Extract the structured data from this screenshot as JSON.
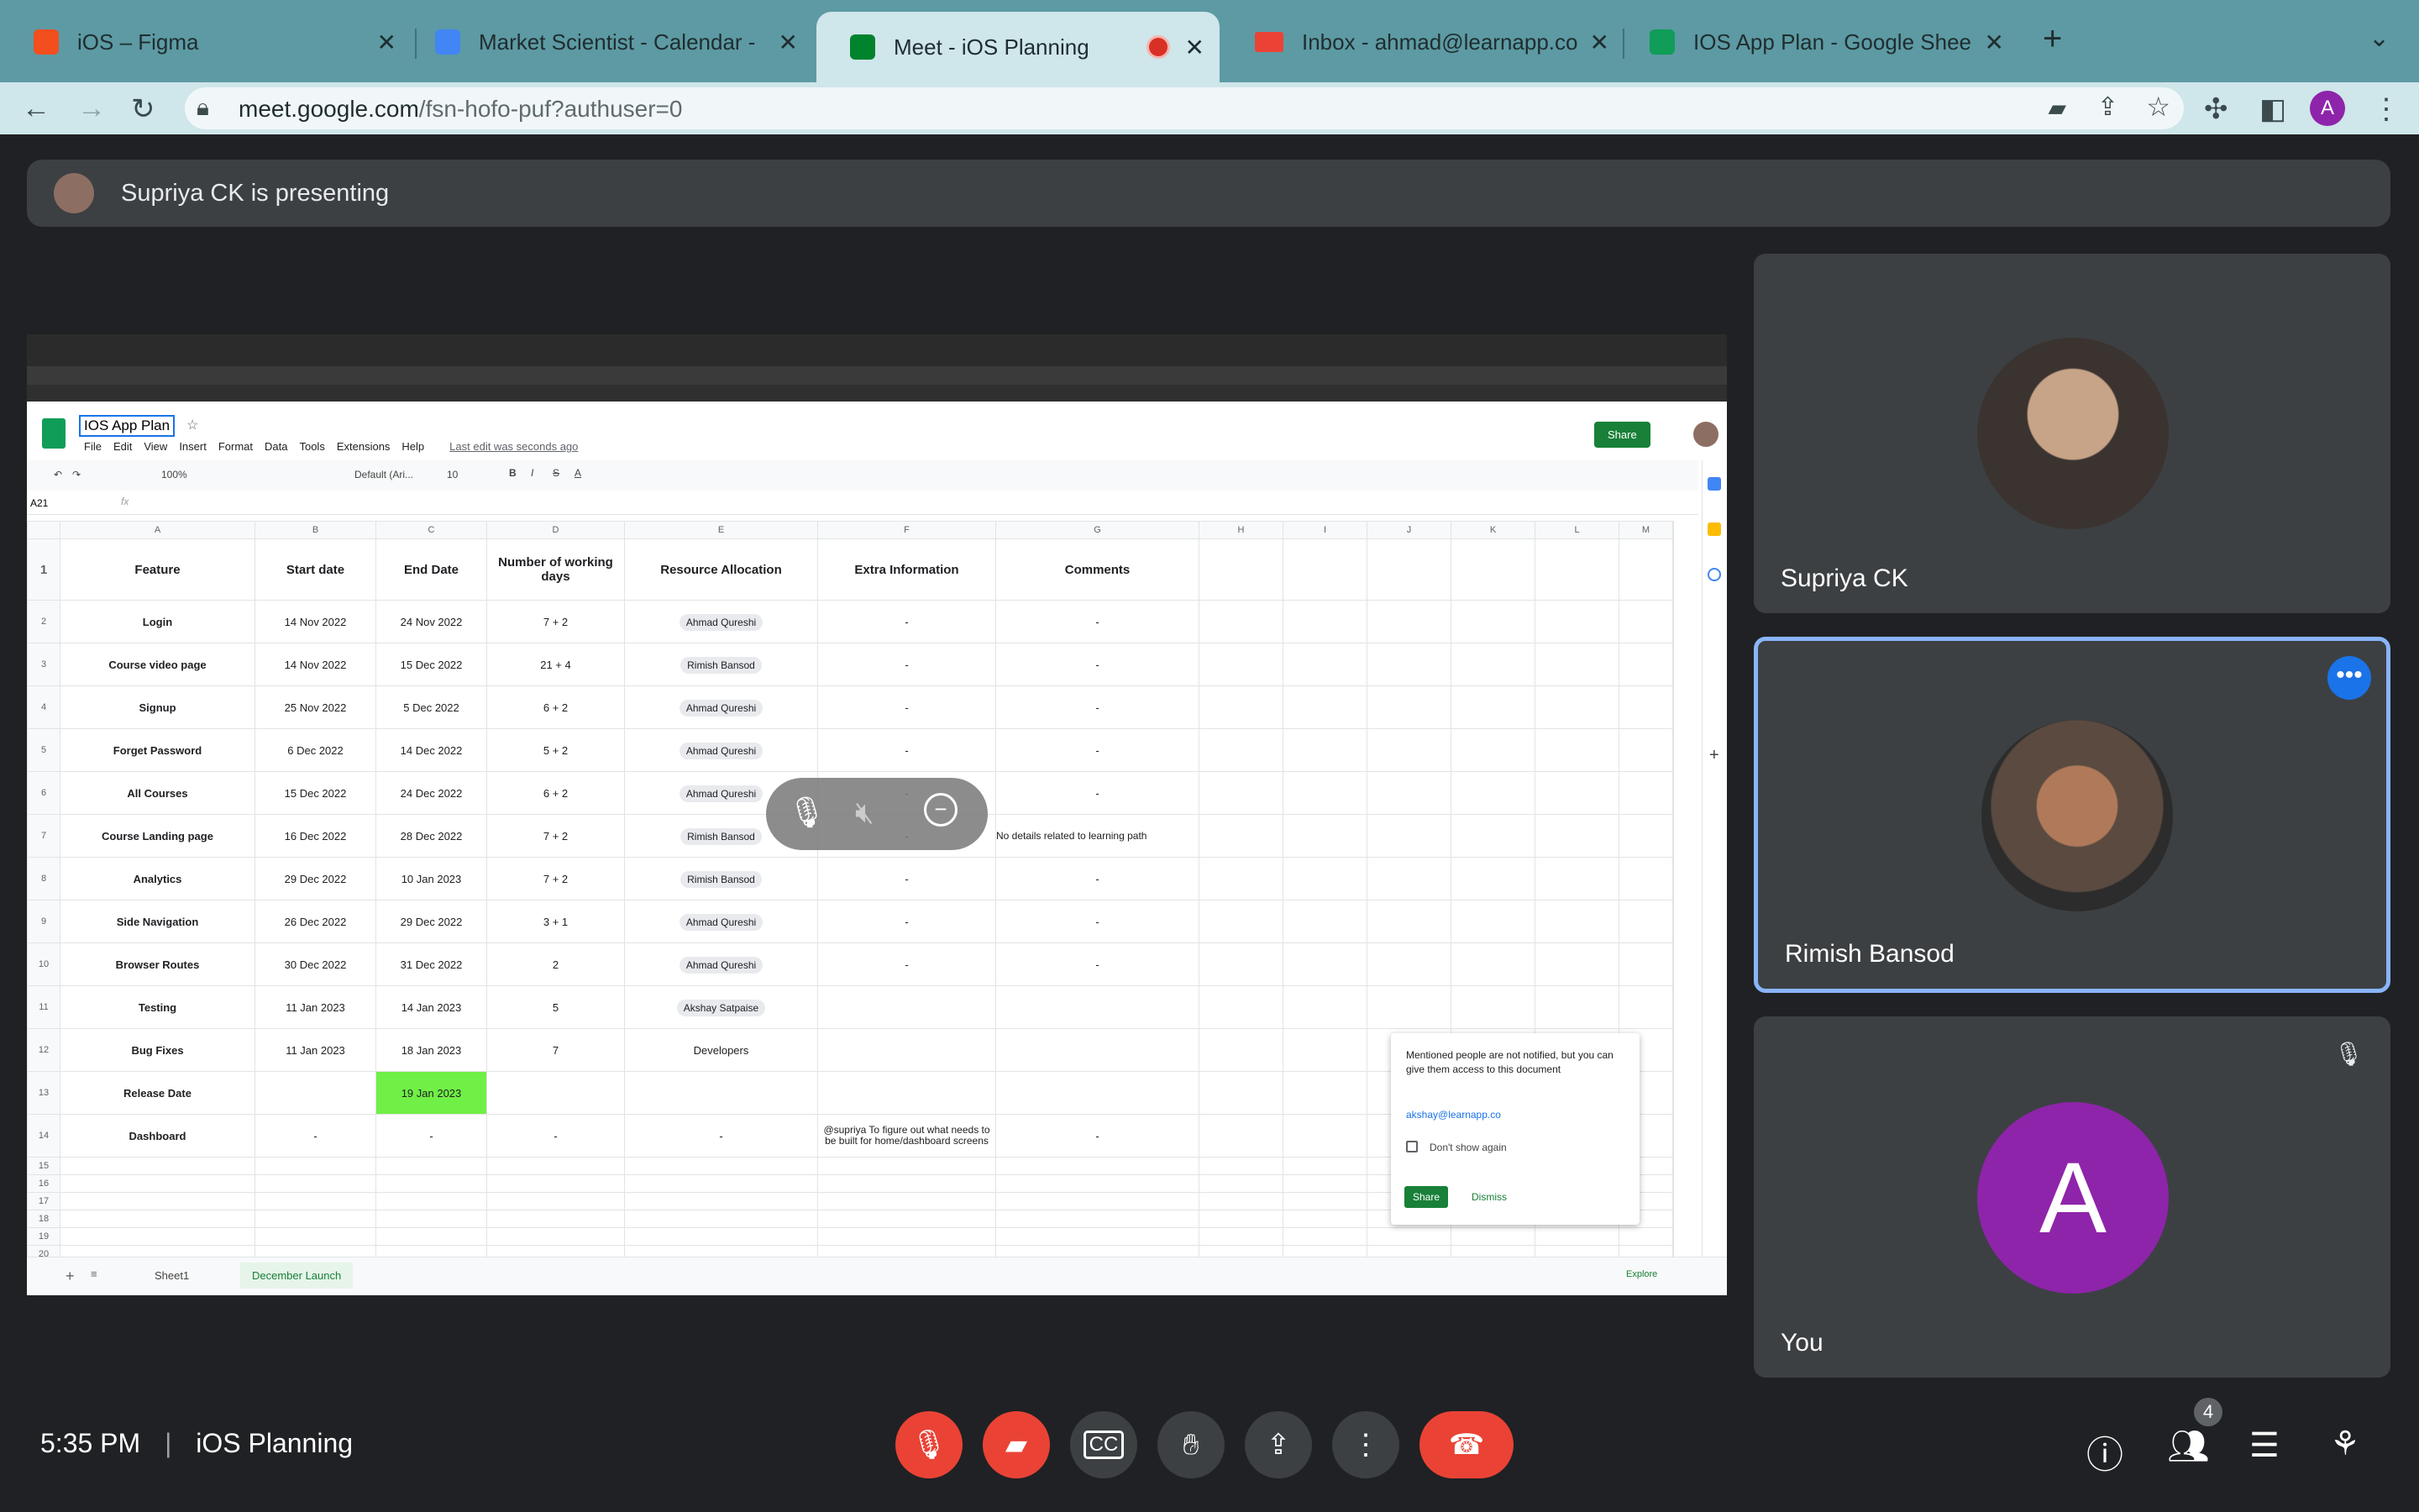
{
  "browser": {
    "tabs": [
      {
        "title": "iOS – Figma",
        "favicon_color": "#f24e1e",
        "active": false
      },
      {
        "title": "Market Scientist - Calendar - W",
        "favicon_color": "#4285f4",
        "active": false
      },
      {
        "title": "Meet - iOS Planning",
        "favicon_color": "#00832d",
        "active": true,
        "recording": true
      },
      {
        "title": "Inbox - ahmad@learnapp.com",
        "favicon_color": "#ea4335",
        "active": false
      },
      {
        "title": "IOS App Plan - Google Sheets",
        "favicon_color": "#0f9d58",
        "active": false
      }
    ],
    "url_domain": "meet.google.com",
    "url_path": "/fsn-hofo-puf?authuser=0",
    "profile_initial": "A",
    "accent": "#5d9aa3"
  },
  "meet": {
    "presenting_text": "Supriya CK is presenting",
    "time": "5:35 PM",
    "separator": "|",
    "meeting_title": "iOS Planning",
    "participant_count": "4",
    "participants": [
      {
        "name": "Supriya CK"
      },
      {
        "name": "Rimish Bansod"
      },
      {
        "name": "You",
        "initial": "A"
      }
    ],
    "controls": [
      "mic-off-icon",
      "camera-off-icon",
      "captions-icon",
      "raise-hand-icon",
      "present-icon",
      "more-options-icon",
      "end-call-icon"
    ],
    "right_controls": [
      "info-icon",
      "people-icon",
      "chat-icon",
      "activities-icon"
    ]
  },
  "sheet": {
    "doc_title": "IOS App Plan",
    "menus": [
      "File",
      "Edit",
      "View",
      "Insert",
      "Format",
      "Data",
      "Tools",
      "Extensions",
      "Help"
    ],
    "last_edit": "Last edit was seconds ago",
    "share_label": "Share",
    "cell_ref": "A21",
    "zoom": "100%",
    "font": "Default (Ari...",
    "font_size": "10",
    "col_letters": [
      "A",
      "B",
      "C",
      "D",
      "E",
      "F",
      "G",
      "H",
      "I",
      "J",
      "K",
      "L",
      "M"
    ],
    "headers": [
      "Feature",
      "Start date",
      "End Date",
      "Number of working days",
      "Resource Allocation",
      "Extra Information",
      "Comments"
    ],
    "rows": [
      [
        "Login",
        "14 Nov 2022",
        "24 Nov 2022",
        "7 + 2",
        "Ahmad Qureshi",
        "-",
        "-"
      ],
      [
        "Course video page",
        "14 Nov 2022",
        "15 Dec 2022",
        "21 + 4",
        "Rimish Bansod",
        "-",
        "-"
      ],
      [
        "Signup",
        "25 Nov 2022",
        "5 Dec 2022",
        "6 + 2",
        "Ahmad Qureshi",
        "-",
        "-"
      ],
      [
        "Forget Password",
        "6 Dec 2022",
        "14 Dec 2022",
        "5 + 2",
        "Ahmad Qureshi",
        "-",
        "-"
      ],
      [
        "All Courses",
        "15 Dec 2022",
        "24 Dec 2022",
        "6 + 2",
        "Ahmad Qureshi",
        "-",
        "-"
      ],
      [
        "Course Landing page",
        "16 Dec 2022",
        "28 Dec 2022",
        "7 + 2",
        "Rimish Bansod",
        "-",
        "No details related to learning path"
      ],
      [
        "Analytics",
        "29 Dec 2022",
        "10 Jan 2023",
        "7 + 2",
        "Rimish Bansod",
        "-",
        "-"
      ],
      [
        "Side Navigation",
        "26 Dec 2022",
        "29 Dec 2022",
        "3 + 1",
        "Ahmad Qureshi",
        "-",
        "-"
      ],
      [
        "Browser Routes",
        "30 Dec 2022",
        "31 Dec 2022",
        "2",
        "Ahmad Qureshi",
        "-",
        "-"
      ],
      [
        "Testing",
        "11 Jan 2023",
        "14 Jan 2023",
        "5",
        "Akshay Satpaise",
        "",
        ""
      ],
      [
        "Bug Fixes",
        "11 Jan 2023",
        "18 Jan 2023",
        "7",
        "Developers",
        "",
        ""
      ],
      [
        "Release Date",
        "",
        "19 Jan 2023",
        "",
        "",
        "",
        ""
      ],
      [
        "Dashboard",
        "-",
        "-",
        "-",
        "-",
        "@supriya To figure out what needs to be built for home/dashboard screens",
        "-"
      ]
    ],
    "tabs": [
      "Sheet1",
      "December Launch"
    ],
    "explore": "Explore",
    "popup": {
      "message": "Mentioned people are not notified, but you can give them access to this document",
      "email": "akshay@learnapp.co",
      "checkbox": "Don't show again",
      "share": "Share",
      "dismiss": "Dismiss"
    },
    "highlight_color": "#70f046"
  }
}
